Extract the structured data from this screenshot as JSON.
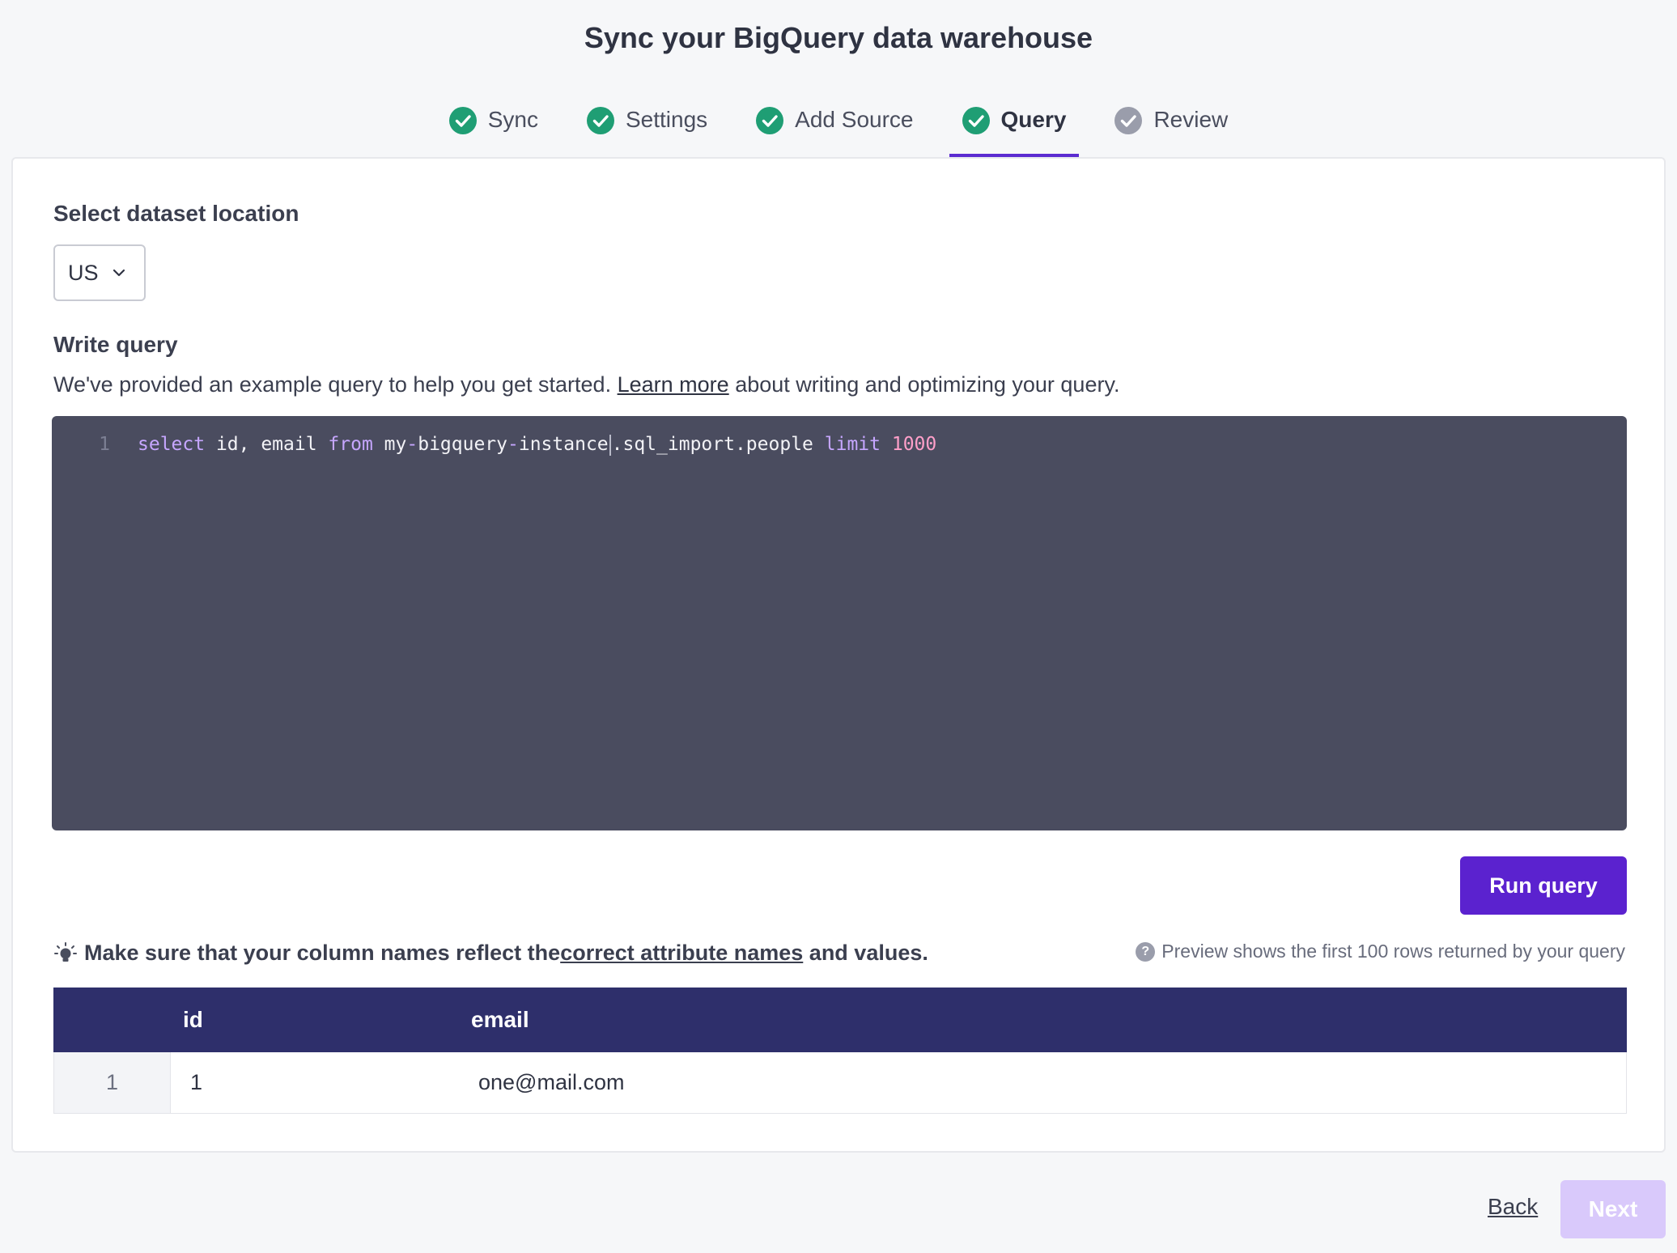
{
  "page": {
    "title": "Sync your BigQuery data warehouse"
  },
  "steps": [
    {
      "label": "Sync",
      "state": "done"
    },
    {
      "label": "Settings",
      "state": "done"
    },
    {
      "label": "Add Source",
      "state": "done"
    },
    {
      "label": "Query",
      "state": "active"
    },
    {
      "label": "Review",
      "state": "pending"
    }
  ],
  "colors": {
    "accent": "#5b22cf",
    "success": "#1f9e74",
    "pending": "#9a9dab",
    "header_bg": "#2e2f6b",
    "editor_bg": "#4a4c5f"
  },
  "location": {
    "label": "Select dataset location",
    "value": "US"
  },
  "query": {
    "label": "Write query",
    "desc_before": "We've provided an example query to help you get started.",
    "learn_more": "Learn more",
    "desc_after": "about writing and optimizing your query.",
    "line_number": "1",
    "tokens": {
      "kw_select": "select",
      "cols": " id, email ",
      "kw_from": "from",
      "table_a": " my",
      "dash1": "-",
      "table_b": "bigquery",
      "dash2": "-",
      "table_c": "instance",
      "table_d": ".sql_import.people ",
      "kw_limit": "limit",
      "num": " 1000"
    }
  },
  "run_button": {
    "label": "Run query"
  },
  "tip": {
    "before": "Make sure that your column names reflect the",
    "link": "correct attribute names",
    "after": " and values."
  },
  "preview_note": {
    "icon_glyph": "?",
    "text": "Preview shows the first 100 rows returned by your query"
  },
  "table": {
    "columns": [
      "id",
      "email"
    ],
    "rows": [
      {
        "index": "1",
        "id": "1",
        "email": "one@mail.com"
      }
    ]
  },
  "footer": {
    "back_label": "Back",
    "next_label": "Next"
  }
}
